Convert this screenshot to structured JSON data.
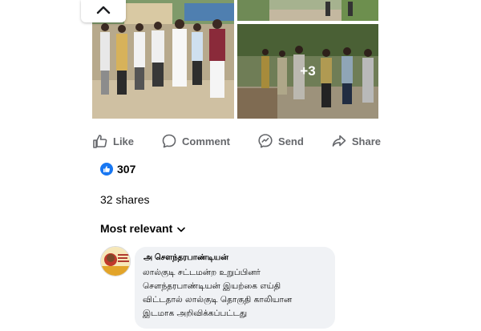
{
  "post": {
    "more_photos_label": "+3"
  },
  "actions": {
    "like_label": "Like",
    "comment_label": "Comment",
    "send_label": "Send",
    "share_label": "Share"
  },
  "reactions": {
    "count": "307"
  },
  "shares": {
    "label": "32 shares"
  },
  "comments_sort": {
    "label": "Most relevant"
  },
  "comment": {
    "author": "அ சௌந்தரபாண்டியன்",
    "text": "லால்குடி சட்டமன்ற உறுப்பினர்\nசௌந்தரபாண்டியன் இயற்கை எய்தி\nவிட்டதால் லால்குடி தொகுதி காலியான\nஇடமாக அறிவிக்கப்பட்டது"
  },
  "colors": {
    "accent": "#1877f2",
    "secondary_text": "#65676b",
    "comment_bubble": "#f0f2f5"
  }
}
